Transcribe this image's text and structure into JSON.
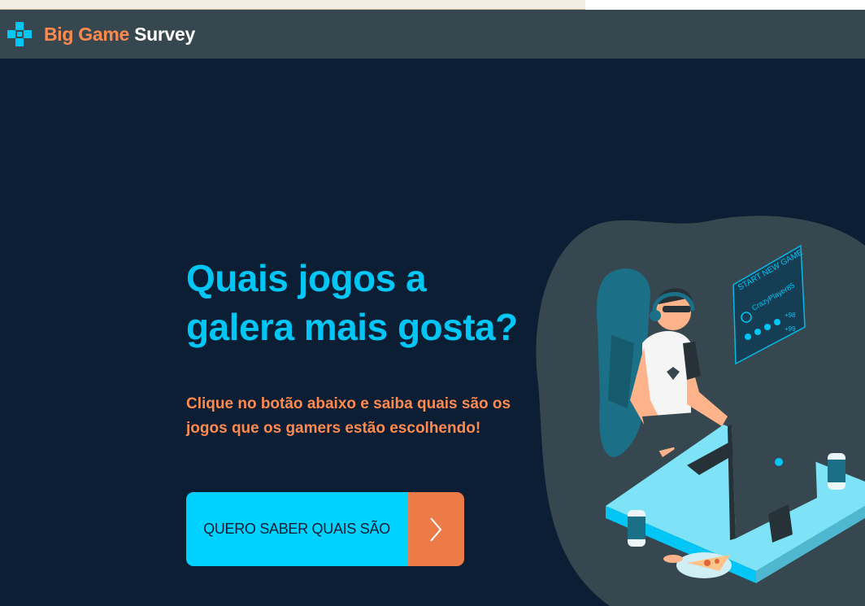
{
  "navbar": {
    "brand_part1": "Big Game",
    "brand_part2": "Survey",
    "logo_icon": "gamepad-cross-icon"
  },
  "hero": {
    "headline_line1": "Quais jogos a",
    "headline_line2": "galera mais gosta?",
    "subtitle_line1": "Clique no botão abaixo e saiba quais são os",
    "subtitle_line2": "jogos que os gamers estão escolhendo!",
    "cta_label": "QUERO SABER QUAIS SÃO",
    "cta_icon": "chevron-right-icon"
  },
  "illustration": {
    "screen_title": "START NEW GAME",
    "player_name": "CrazyPlayer85",
    "stat_1": "+98",
    "stat_2": "+99"
  },
  "colors": {
    "background": "#0b1e33",
    "navbar": "#37474f",
    "accent_blue": "#00c6f5",
    "accent_orange": "#ff8a50",
    "button_blue": "#00d2ff",
    "button_orange": "#ed7b48"
  }
}
